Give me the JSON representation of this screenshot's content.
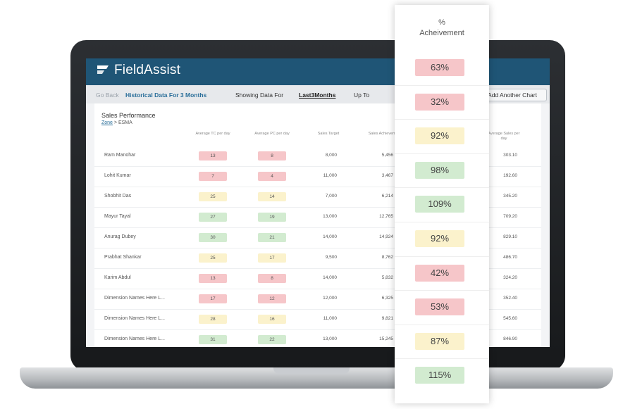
{
  "app": {
    "brand": "FieldAssist",
    "toolbar": {
      "back": "Go Back",
      "historical": "Historical Data For 3 Months",
      "showing": "Showing Data For",
      "period": "Last3Months",
      "upto": "Up To",
      "another_chart": "Add Another Chart"
    },
    "card": {
      "title": "Sales Performance",
      "breadcrumb_link": "Zone",
      "breadcrumb_rest": " > ESMA"
    },
    "columns": [
      "Average TC per day",
      "Average PC per day",
      "Sales Target",
      "Sales Achievement",
      "Average Sales per day"
    ],
    "rows": [
      {
        "name": "Ram Manohar",
        "tc": "13",
        "pc": "8",
        "target": "8,000",
        "achievement": "5,456",
        "avg_sales": "303.10",
        "status": "red"
      },
      {
        "name": "Lohit Kumar",
        "tc": "7",
        "pc": "4",
        "target": "11,000",
        "achievement": "3,467",
        "avg_sales": "192.60",
        "status": "red"
      },
      {
        "name": "Shobhit Das",
        "tc": "25",
        "pc": "14",
        "target": "7,000",
        "achievement": "6,214",
        "avg_sales": "345.20",
        "status": "yellow"
      },
      {
        "name": "Mayur Tayal",
        "tc": "27",
        "pc": "19",
        "target": "13,000",
        "achievement": "12,765",
        "avg_sales": "709.20",
        "status": "green"
      },
      {
        "name": "Anurag Dubey",
        "tc": "30",
        "pc": "21",
        "target": "14,000",
        "achievement": "14,924",
        "avg_sales": "829.10",
        "status": "green"
      },
      {
        "name": "Prabhat Shankar",
        "tc": "25",
        "pc": "17",
        "target": "9,500",
        "achievement": "8,762",
        "avg_sales": "486.70",
        "status": "yellow"
      },
      {
        "name": "Karim Abdul",
        "tc": "13",
        "pc": "8",
        "target": "14,000",
        "achievement": "5,832",
        "avg_sales": "324.20",
        "status": "red"
      },
      {
        "name": "Dimension Names Here L...",
        "tc": "17",
        "pc": "12",
        "target": "12,000",
        "achievement": "6,325",
        "avg_sales": "352.40",
        "status": "red"
      },
      {
        "name": "Dimension Names Here L...",
        "tc": "28",
        "pc": "16",
        "target": "11,000",
        "achievement": "9,821",
        "avg_sales": "545.60",
        "status": "yellow"
      },
      {
        "name": "Dimension Names Here L...",
        "tc": "31",
        "pc": "22",
        "target": "13,000",
        "achievement": "15,245",
        "avg_sales": "846.90",
        "status": "green"
      }
    ]
  },
  "panel": {
    "title_line1": "%",
    "title_line2": "Acheivement",
    "values": [
      {
        "value": "63%",
        "status": "red"
      },
      {
        "value": "32%",
        "status": "red"
      },
      {
        "value": "92%",
        "status": "yellow"
      },
      {
        "value": "98%",
        "status": "green"
      },
      {
        "value": "109%",
        "status": "green"
      },
      {
        "value": "92%",
        "status": "yellow"
      },
      {
        "value": "42%",
        "status": "red"
      },
      {
        "value": "53%",
        "status": "red"
      },
      {
        "value": "87%",
        "status": "yellow"
      },
      {
        "value": "115%",
        "status": "green"
      }
    ]
  },
  "colors": {
    "header": "#1f5576",
    "red": "#f6c6c9",
    "yellow": "#fbf2cc",
    "green": "#d2ebd0"
  }
}
